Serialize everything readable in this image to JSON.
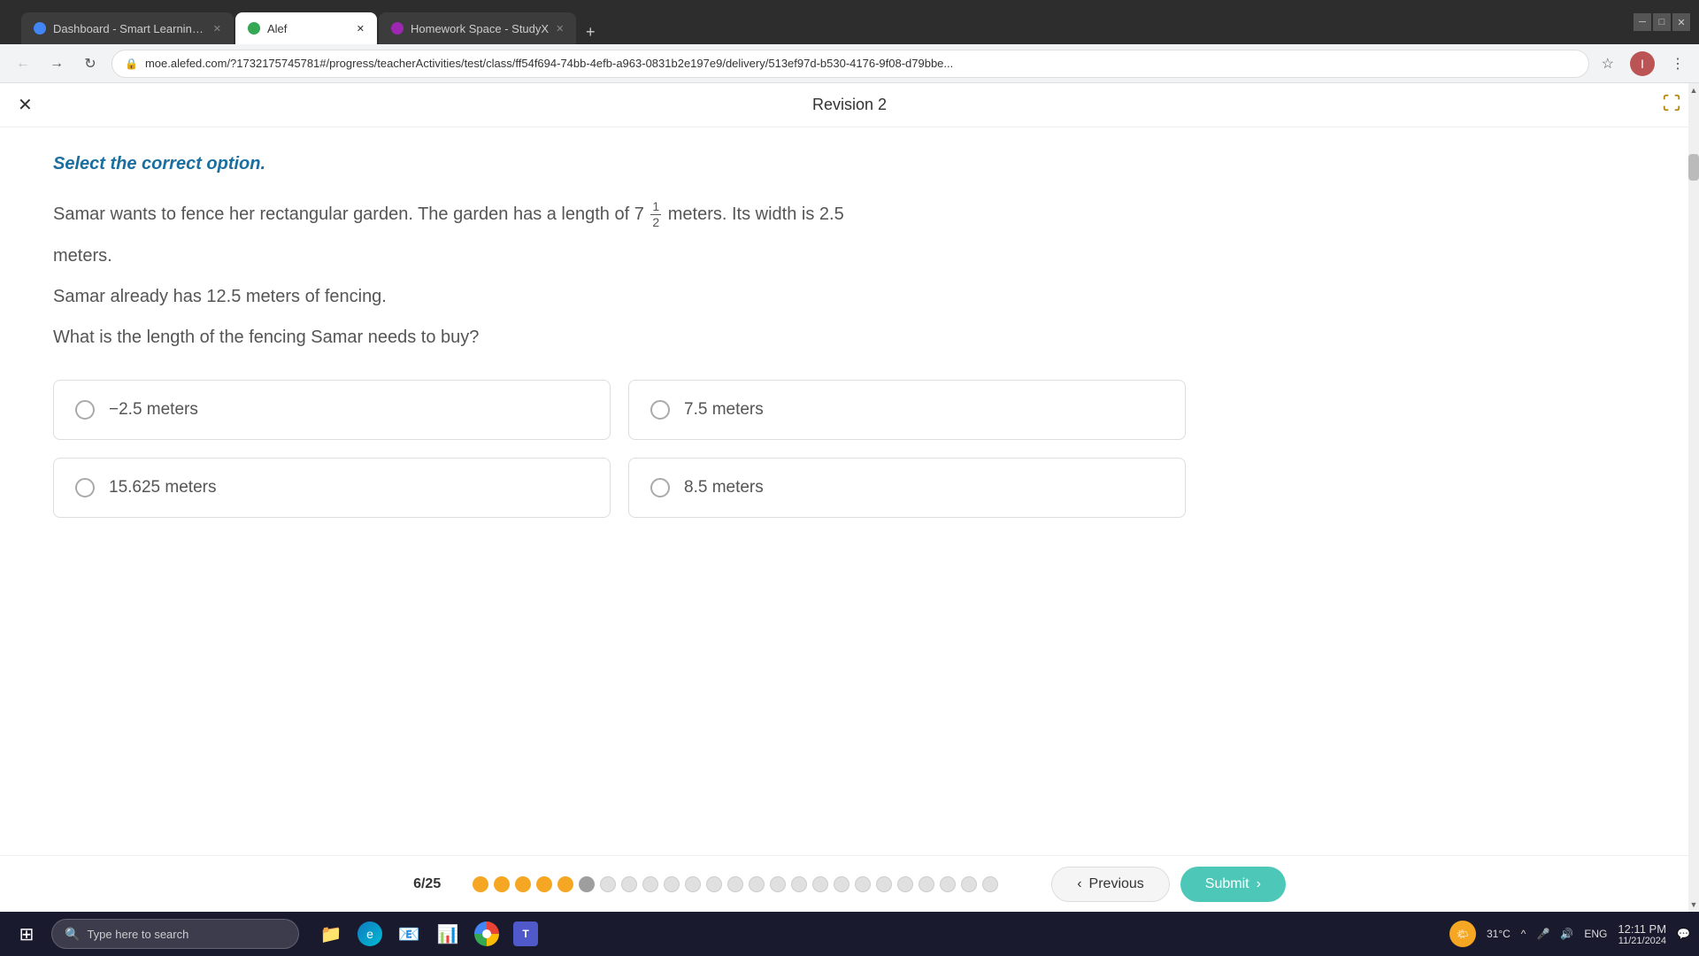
{
  "browser": {
    "tabs": [
      {
        "id": "tab1",
        "label": "Dashboard - Smart Learning Ga",
        "active": false,
        "icon_color": "#4285f4"
      },
      {
        "id": "tab2",
        "label": "Alef",
        "active": true,
        "icon_color": "#34a853"
      },
      {
        "id": "tab3",
        "label": "Homework Space - StudyX",
        "active": false,
        "icon_color": "#9c27b0"
      }
    ],
    "url": "moe.alefed.com/?1732175745781#/progress/teacherActivities/test/class/ff54f694-74bb-4efb-a963-0831b2e197e9/delivery/513ef97d-b530-4176-9f08-d79bbe...",
    "new_tab_label": "+"
  },
  "page": {
    "title": "Revision 2",
    "close_icon": "✕",
    "expand_icon": "⤢"
  },
  "question": {
    "instruction": "Select the correct option.",
    "text_part1": "Samar wants to fence her rectangular garden. The garden has a length of 7",
    "fraction_num": "1",
    "fraction_den": "2",
    "text_part2": "meters. Its width is 2.5",
    "text_line2": "meters.",
    "text_line3": "Samar already has 12.5 meters of fencing.",
    "text_line4": "What is the length of the fencing Samar needs to buy?",
    "options": [
      {
        "id": "A",
        "text": "−2.5 meters"
      },
      {
        "id": "B",
        "text": "7.5 meters"
      },
      {
        "id": "C",
        "text": "15.625 meters"
      },
      {
        "id": "D",
        "text": "8.5 meters"
      }
    ]
  },
  "pagination": {
    "current": "6",
    "total": "25",
    "counter_label": "6/25",
    "dots": [
      {
        "type": "answered-orange"
      },
      {
        "type": "answered-orange"
      },
      {
        "type": "answered-orange"
      },
      {
        "type": "answered-orange"
      },
      {
        "type": "answered-orange"
      },
      {
        "type": "current"
      },
      {
        "type": "unanswered"
      },
      {
        "type": "unanswered"
      },
      {
        "type": "unanswered"
      },
      {
        "type": "unanswered"
      },
      {
        "type": "unanswered"
      },
      {
        "type": "unanswered"
      },
      {
        "type": "unanswered"
      },
      {
        "type": "unanswered"
      },
      {
        "type": "unanswered"
      },
      {
        "type": "unanswered"
      },
      {
        "type": "unanswered"
      },
      {
        "type": "unanswered"
      },
      {
        "type": "unanswered"
      },
      {
        "type": "unanswered"
      },
      {
        "type": "unanswered"
      },
      {
        "type": "unanswered"
      },
      {
        "type": "unanswered"
      },
      {
        "type": "unanswered"
      },
      {
        "type": "unanswered"
      }
    ]
  },
  "navigation": {
    "previous_label": "Previous",
    "submit_label": "Submit",
    "prev_arrow": "‹",
    "submit_arrow": "›"
  },
  "taskbar": {
    "search_placeholder": "Type here to search",
    "time": "12:11 PM",
    "date": "11/21/2024",
    "temperature": "31°C",
    "language": "ENG",
    "apps": [
      "📁",
      "🌐",
      "📧",
      "📊",
      "🌐"
    ]
  }
}
